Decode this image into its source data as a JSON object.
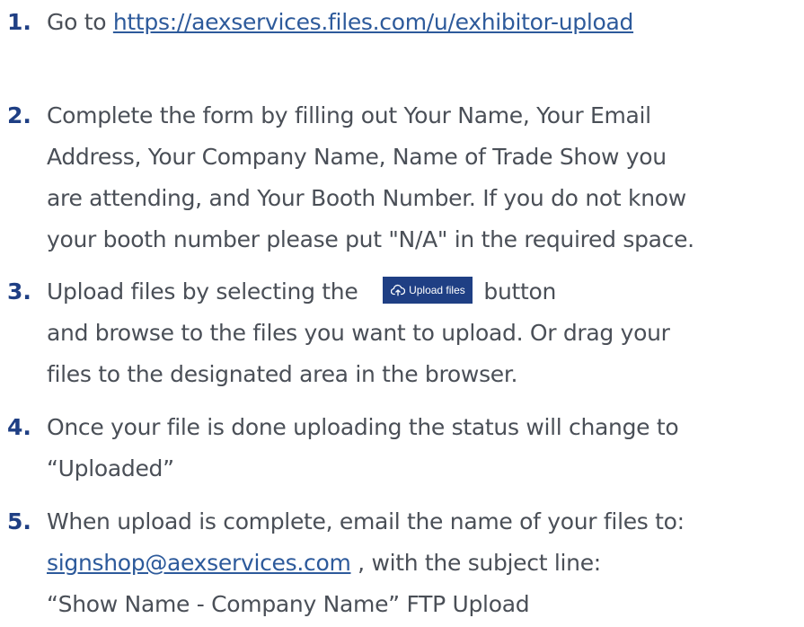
{
  "steps": [
    {
      "number": "1.",
      "prefix": "Go to ",
      "link": "https://aexservices.files.com/u/exhibitor-upload"
    },
    {
      "number": "2.",
      "lines": [
        "Complete the form by filling out Your Name, Your Email",
        "Address, Your Company Name, Name of Trade Show you",
        "are attending, and Your Booth Number. If you do not know",
        "your booth number please put \"N/A\" in the required space."
      ]
    },
    {
      "number": "3.",
      "prefix": "Upload files by selecting the",
      "button_label": "Upload files",
      "suffix": "button",
      "lines": [
        "and browse to the files you want to upload. Or drag your",
        "files to the designated area in the browser."
      ]
    },
    {
      "number": "4.",
      "lines": [
        "Once your file is done uploading the status will change to",
        "“Uploaded”"
      ]
    },
    {
      "number": "5.",
      "line1": "When upload is complete, email the name of your files to:",
      "email": "signshop@aexservices.com",
      "line2_suffix": " , with the subject line:",
      "line3": "“Show Name - Company Name” FTP Upload"
    }
  ],
  "colors": {
    "number": "#1f3f84",
    "text": "#4a4f57",
    "link": "#2d5a9b",
    "button_bg": "#1f3f84"
  },
  "icons": {
    "upload": "cloud-upload-icon"
  }
}
